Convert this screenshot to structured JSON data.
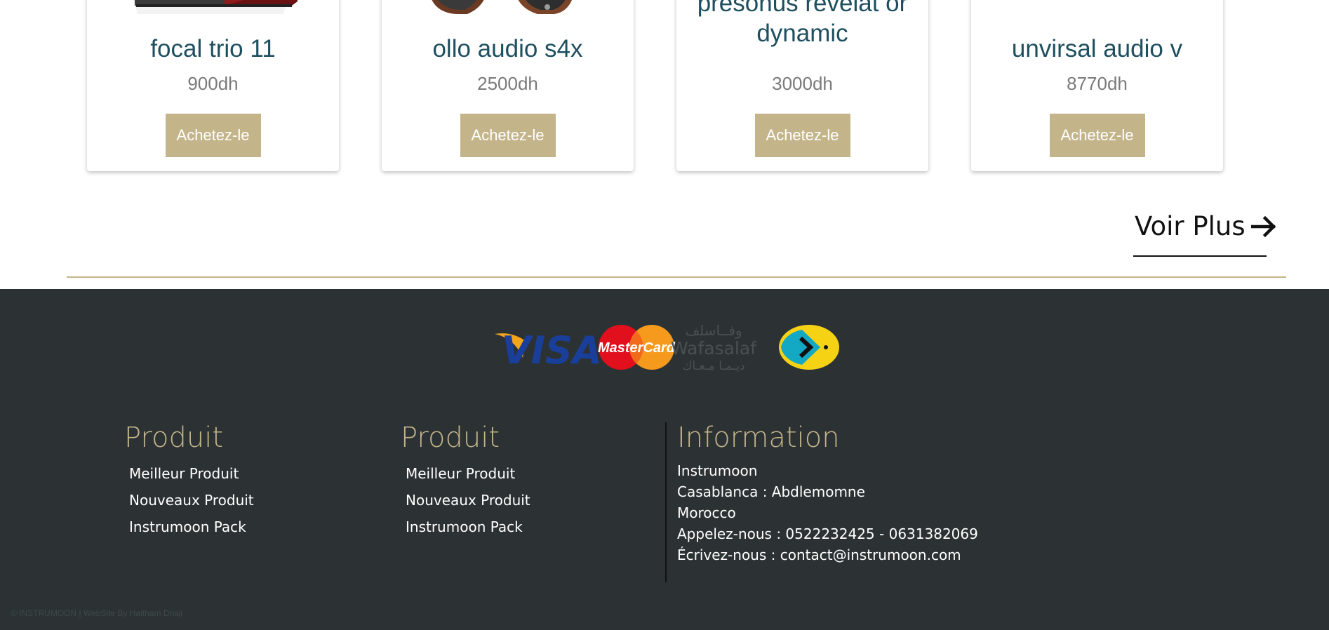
{
  "products": [
    {
      "name": "focal trio 11",
      "price": "900dh",
      "buy_label": "Achetez-le"
    },
    {
      "name": "ollo audio s4x",
      "price": "2500dh",
      "buy_label": "Achetez-le"
    },
    {
      "name": "presonus revelat or dynamic",
      "price": "3000dh",
      "buy_label": "Achetez-le"
    },
    {
      "name": "unvirsal audio v",
      "price": "8770dh",
      "buy_label": "Achetez-le"
    }
  ],
  "voir_plus": {
    "label": "Voir Plus"
  },
  "payments": {
    "visa": "VISA",
    "mastercard": "MasterCard",
    "wafasalaf_latin": "Wafasalaf",
    "wafasalaf_arabic_top": "وفــاسلف",
    "wafasalaf_arabic_bottom": "ديـمـا مـعـاك"
  },
  "footer": {
    "col1": {
      "title": "Produit",
      "links": [
        "Meilleur Produit",
        "Nouveaux Produit",
        "Instrumoon Pack"
      ]
    },
    "col2": {
      "title": "Produit",
      "links": [
        "Meilleur Produit",
        "Nouveaux Produit",
        "Instrumoon Pack"
      ]
    },
    "info": {
      "title": "Information",
      "lines": [
        "Instrumoon",
        "Casablanca : Abdlemomne",
        "Morocco",
        "Appelez-nous : 0522232425 - 0631382069",
        "Écrivez-nous : contact@instrumoon.com"
      ]
    },
    "copyright": "© INSTRUMOON | WebSite By Haitham Driaji"
  },
  "colors": {
    "accent": "#c3b48a",
    "product_name": "#1e4f5f",
    "footer_bg": "#2c3233"
  }
}
